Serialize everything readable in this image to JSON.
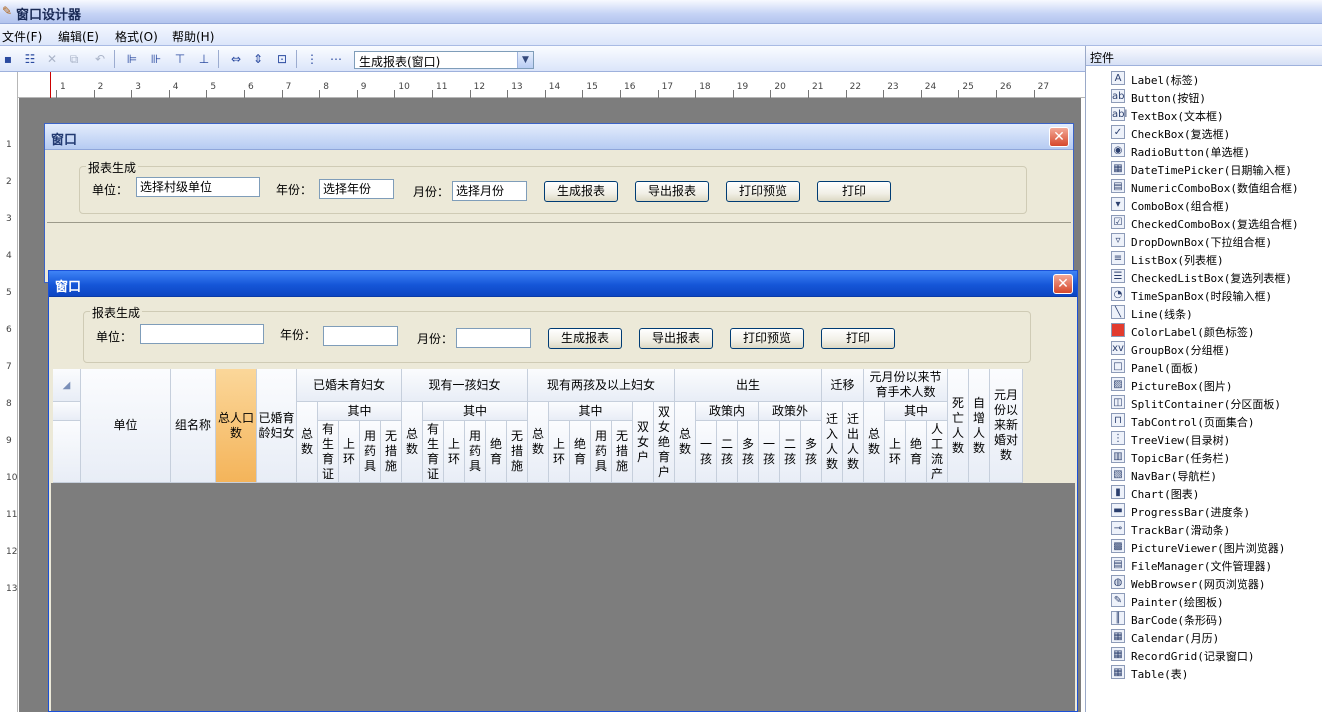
{
  "app": {
    "title": "窗口设计器",
    "icon": "pencil-icon"
  },
  "menu": [
    {
      "label": "文件(F)"
    },
    {
      "label": "编辑(E)"
    },
    {
      "label": "格式(O)"
    },
    {
      "label": "帮助(H)"
    }
  ],
  "toolbar": {
    "combo_value": "生成报表(窗口)"
  },
  "ruler": {
    "numbers": [
      "1",
      "2",
      "3",
      "4",
      "5",
      "6",
      "7",
      "8",
      "9",
      "10",
      "11",
      "12",
      "13",
      "14",
      "15",
      "16",
      "17",
      "18",
      "19",
      "20",
      "21",
      "22",
      "23",
      "24",
      "25",
      "26",
      "27"
    ],
    "left_numbers": [
      "1",
      "2",
      "3",
      "4",
      "5",
      "6",
      "7",
      "8",
      "9",
      "10",
      "11",
      "12",
      "13"
    ]
  },
  "form_back": {
    "title": "窗口",
    "group_title": "报表生成",
    "unit_label": "单位：",
    "unit_value": "选择村级单位",
    "year_label": "年份：",
    "year_value": "选择年份",
    "month_label": "月份：",
    "month_value": "选择月份",
    "btn_generate": "生成报表",
    "btn_export": "导出报表",
    "btn_preview": "打印预览",
    "btn_print": "打印"
  },
  "form_front": {
    "title": "窗口",
    "group_title": "报表生成",
    "unit_label": "单位：",
    "unit_value": "",
    "year_label": "年份：",
    "year_value": "",
    "month_label": "月份：",
    "month_value": "",
    "btn_generate": "生成报表",
    "btn_export": "导出报表",
    "btn_preview": "打印预览",
    "btn_print": "打印"
  },
  "grid_headers": {
    "unit": "单位",
    "group": "组名称",
    "total_pop": "总人口数",
    "married_women": "已婚育龄妇女",
    "g1": "已婚未育妇女",
    "g2": "现有一孩妇女",
    "g3": "现有两孩及以上妇女",
    "g4": "出生",
    "g5": "迁移",
    "g6": "元月份以来节育手术人数",
    "death": "死亡人数",
    "increase": "自增人数",
    "newly_wed": "元月份以来新婚对数",
    "qizhong": "其中",
    "policy_in": "政策内",
    "policy_out": "政策外",
    "total": "总数",
    "cert": "有生育证",
    "ring": "上环",
    "drug": "用药具",
    "none": "无措施",
    "steril": "绝育",
    "double_girl": "双女户",
    "double_girl_steril": "双女绝育户",
    "one": "一孩",
    "two": "二孩",
    "multi": "多孩",
    "move_in": "迁入人数",
    "move_out": "迁出人数",
    "abortion": "人工流产"
  },
  "controls_panel": {
    "title": "控件",
    "items": [
      {
        "icon": "A",
        "label": "Label(标签)",
        "icon_name": "label-icon"
      },
      {
        "icon": "ab",
        "label": "Button(按钮)",
        "icon_name": "button-icon"
      },
      {
        "icon": "abl",
        "label": "TextBox(文本框)",
        "icon_name": "textbox-icon"
      },
      {
        "icon": "✓",
        "label": "CheckBox(复选框)",
        "icon_name": "checkbox-icon"
      },
      {
        "icon": "◉",
        "label": "RadioButton(单选框)",
        "icon_name": "radio-icon"
      },
      {
        "icon": "▦",
        "label": "DateTimePicker(日期输入框)",
        "icon_name": "datetime-icon"
      },
      {
        "icon": "▤",
        "label": "NumericComboBox(数值组合框)",
        "icon_name": "numeric-combo-icon"
      },
      {
        "icon": "▾",
        "label": "ComboBox(组合框)",
        "icon_name": "combobox-icon"
      },
      {
        "icon": "☑",
        "label": "CheckedComboBox(复选组合框)",
        "icon_name": "checked-combo-icon"
      },
      {
        "icon": "▿",
        "label": "DropDownBox(下拉组合框)",
        "icon_name": "dropdown-icon"
      },
      {
        "icon": "≡",
        "label": "ListBox(列表框)",
        "icon_name": "listbox-icon"
      },
      {
        "icon": "☰",
        "label": "CheckedListBox(复选列表框)",
        "icon_name": "checked-list-icon"
      },
      {
        "icon": "◔",
        "label": "TimeSpanBox(时段输入框)",
        "icon_name": "timespan-icon"
      },
      {
        "icon": "╲",
        "label": "Line(线条)",
        "icon_name": "line-icon"
      },
      {
        "icon": "■",
        "label": "ColorLabel(颜色标签)",
        "icon_name": "color-label-icon"
      },
      {
        "icon": "xv",
        "label": "GroupBox(分组框)",
        "icon_name": "groupbox-icon"
      },
      {
        "icon": "□",
        "label": "Panel(面板)",
        "icon_name": "panel-icon"
      },
      {
        "icon": "▨",
        "label": "PictureBox(图片)",
        "icon_name": "picturebox-icon"
      },
      {
        "icon": "◫",
        "label": "SplitContainer(分区面板)",
        "icon_name": "split-container-icon"
      },
      {
        "icon": "⊓",
        "label": "TabControl(页面集合)",
        "icon_name": "tabcontrol-icon"
      },
      {
        "icon": "⋮",
        "label": "TreeView(目录树)",
        "icon_name": "treeview-icon"
      },
      {
        "icon": "▥",
        "label": "TopicBar(任务栏)",
        "icon_name": "topicbar-icon"
      },
      {
        "icon": "▧",
        "label": "NavBar(导航栏)",
        "icon_name": "navbar-icon"
      },
      {
        "icon": "▮",
        "label": "Chart(图表)",
        "icon_name": "chart-icon"
      },
      {
        "icon": "▬",
        "label": "ProgressBar(进度条)",
        "icon_name": "progressbar-icon"
      },
      {
        "icon": "⊸",
        "label": "TrackBar(滑动条)",
        "icon_name": "trackbar-icon"
      },
      {
        "icon": "▩",
        "label": "PictureViewer(图片浏览器)",
        "icon_name": "picture-viewer-icon"
      },
      {
        "icon": "▤",
        "label": "FileManager(文件管理器)",
        "icon_name": "file-manager-icon"
      },
      {
        "icon": "◍",
        "label": "WebBrowser(网页浏览器)",
        "icon_name": "web-browser-icon"
      },
      {
        "icon": "✎",
        "label": "Painter(绘图板)",
        "icon_name": "painter-icon"
      },
      {
        "icon": "║",
        "label": "BarCode(条形码)",
        "icon_name": "barcode-icon"
      },
      {
        "icon": "▦",
        "label": "Calendar(月历)",
        "icon_name": "calendar-icon"
      },
      {
        "icon": "▦",
        "label": "RecordGrid(记录窗口)",
        "icon_name": "record-grid-icon"
      },
      {
        "icon": "▦",
        "label": "Table(表)",
        "icon_name": "table-icon"
      }
    ]
  }
}
